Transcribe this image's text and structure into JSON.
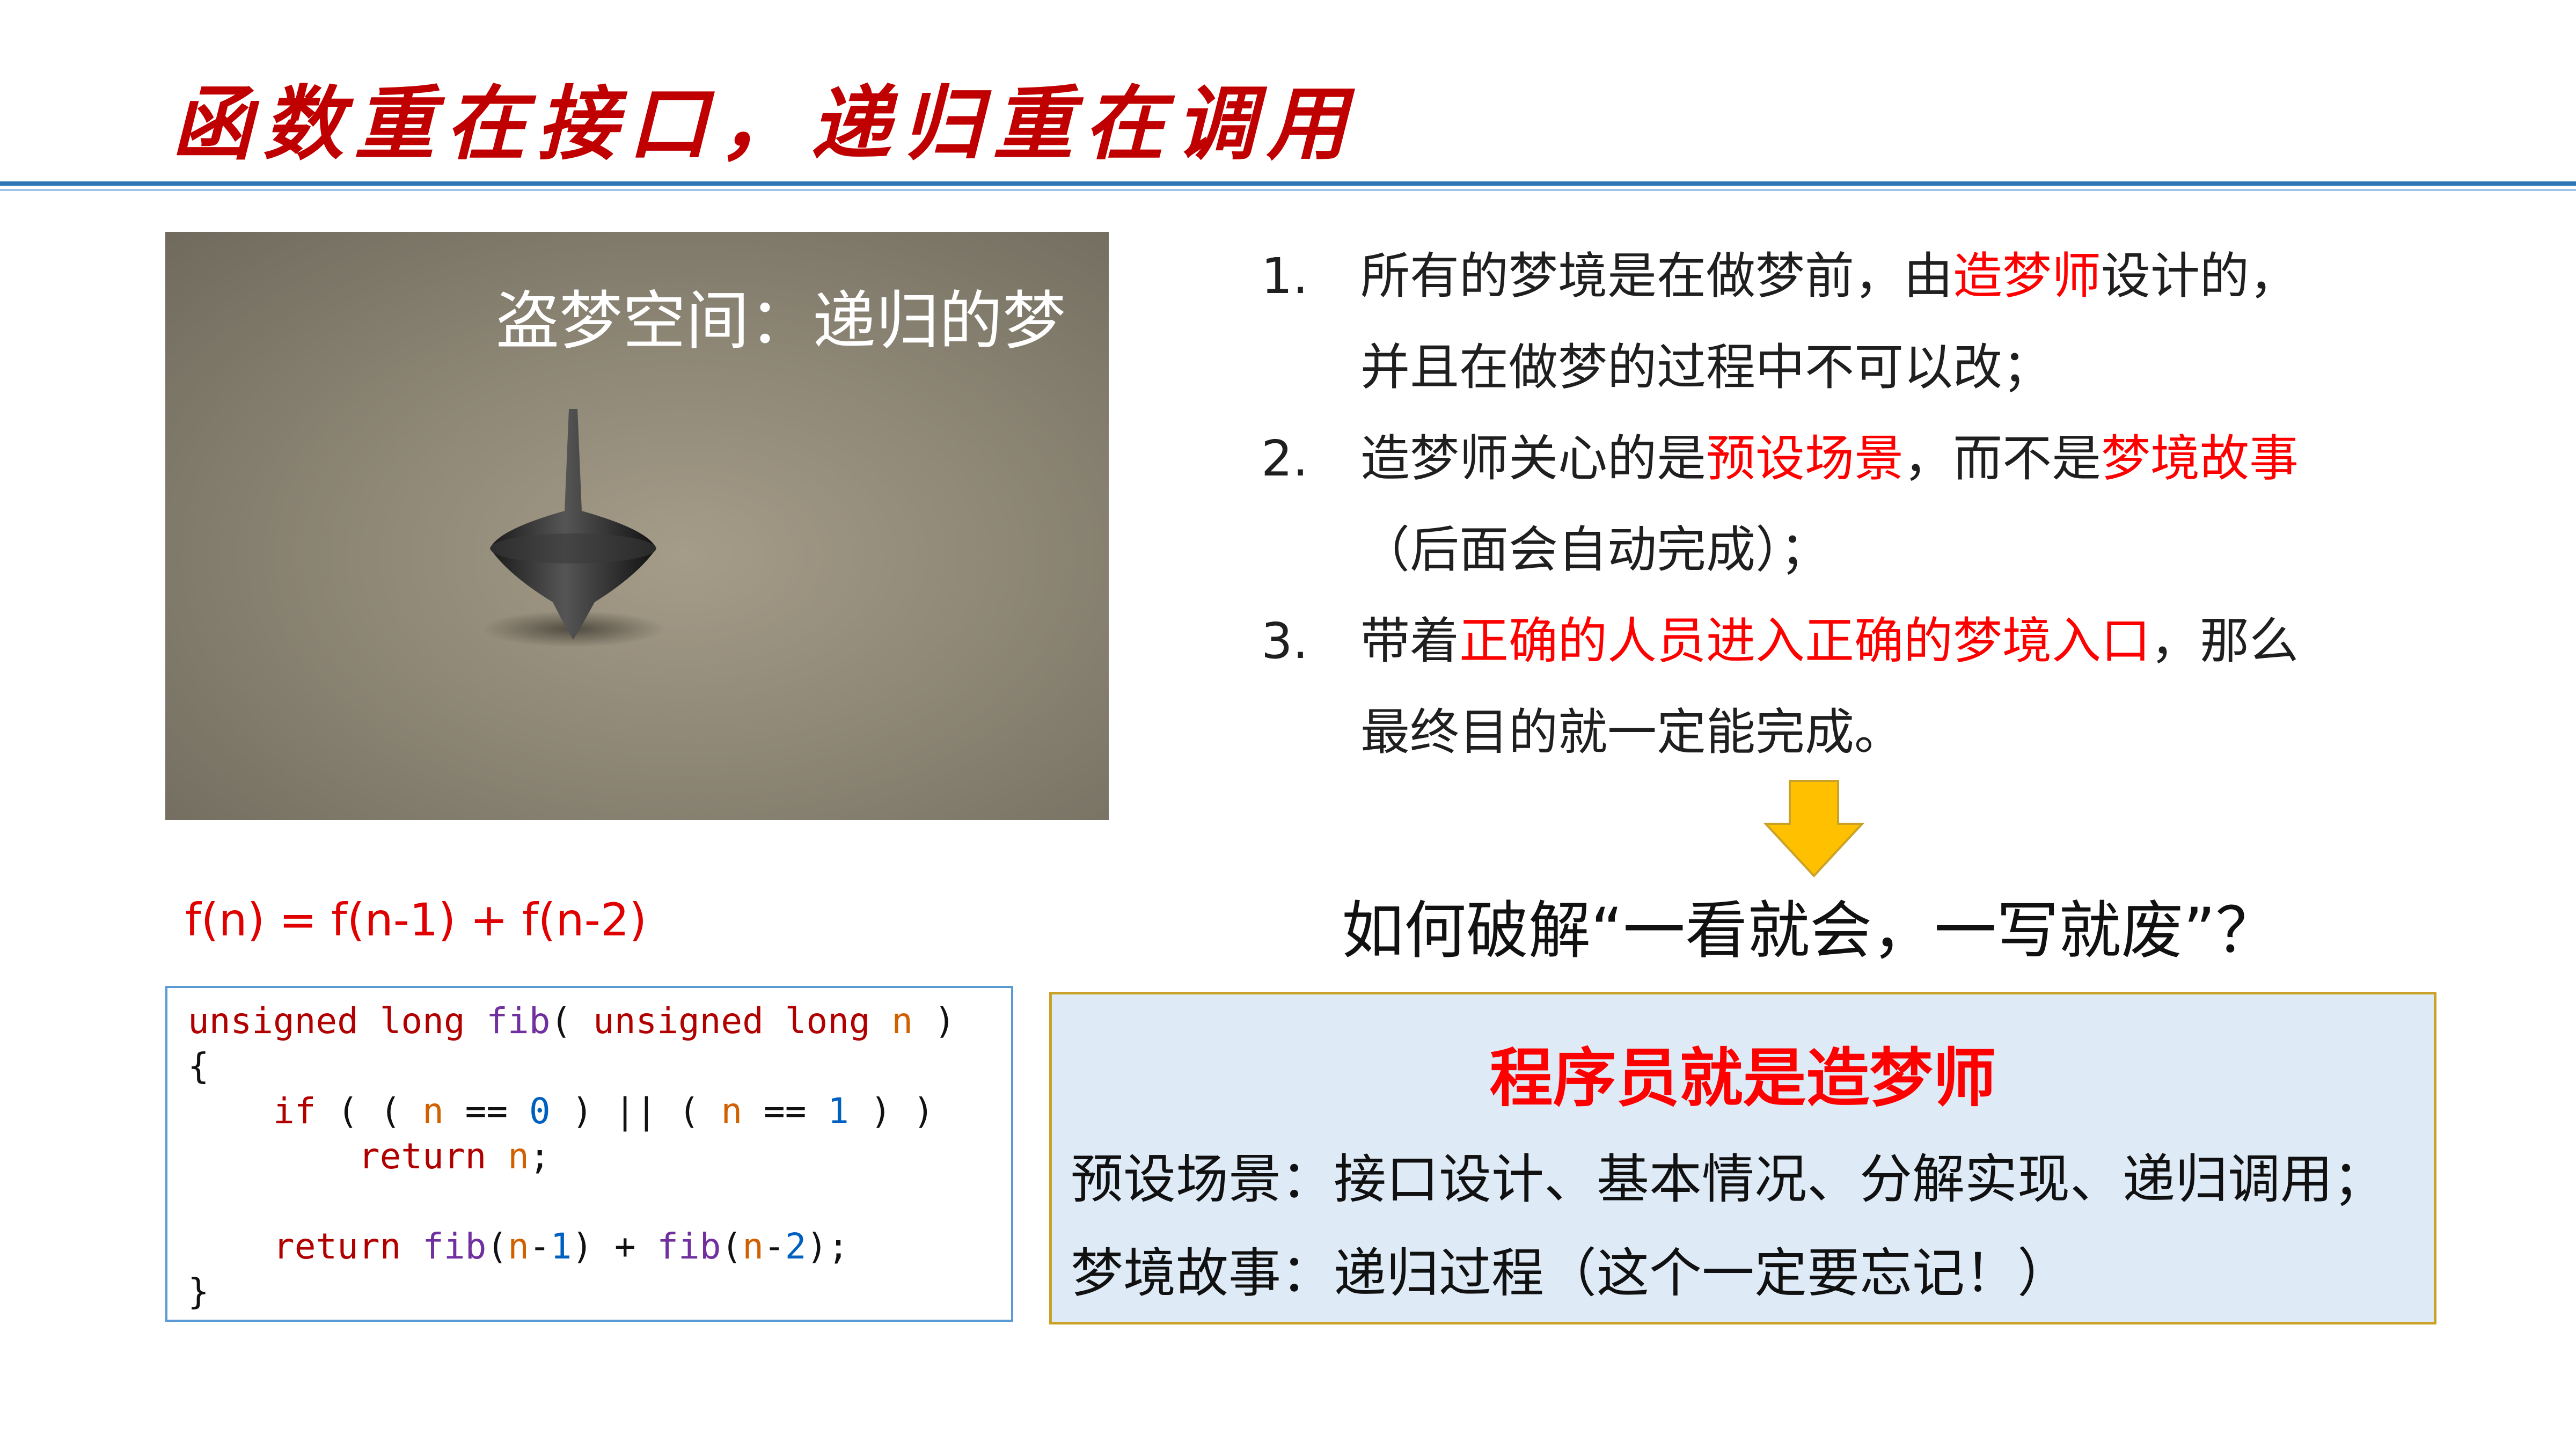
{
  "title": "函数重在接口，递归重在调用",
  "photo": {
    "caption": "盗梦空间：递归的梦",
    "icon": "spinning-top"
  },
  "list": [
    {
      "num": "1.",
      "line1": [
        {
          "text": "所有的梦境是在做梦前，由"
        },
        {
          "text": "造梦师",
          "hl": true
        },
        {
          "text": "设计的，"
        }
      ],
      "line2": [
        {
          "text": "并且在做梦的过程中不可以改；"
        }
      ]
    },
    {
      "num": "2.",
      "line1": [
        {
          "text": "造梦师关心的是"
        },
        {
          "text": "预设场景",
          "hl": true
        },
        {
          "text": "，而不是"
        },
        {
          "text": "梦境故事",
          "hl": true
        }
      ],
      "line2": [
        {
          "text": "（后面会自动完成）；"
        }
      ]
    },
    {
      "num": "3.",
      "line1": [
        {
          "text": "带着"
        },
        {
          "text": "正确的人员进入正确的梦境入口",
          "hl": true
        },
        {
          "text": "，那么"
        }
      ],
      "line2": [
        {
          "text": "最终目的就一定能完成。"
        }
      ]
    }
  ],
  "question": "如何破解“一看就会，一写就废”？",
  "formula": "f(n) = f(n-1) + f(n-2)",
  "code_lines": [
    [
      {
        "t": "unsigned long ",
        "c": "kw"
      },
      {
        "t": "fib",
        "c": "fn"
      },
      {
        "t": "( "
      },
      {
        "t": "unsigned long ",
        "c": "kw"
      },
      {
        "t": "n",
        "c": "var"
      },
      {
        "t": " )"
      }
    ],
    [
      {
        "t": "{"
      }
    ],
    [
      {
        "t": "    "
      },
      {
        "t": "if",
        "c": "kw"
      },
      {
        "t": " ( ( "
      },
      {
        "t": "n",
        "c": "var"
      },
      {
        "t": " == "
      },
      {
        "t": "0",
        "c": "lit"
      },
      {
        "t": " ) || ( "
      },
      {
        "t": "n",
        "c": "var"
      },
      {
        "t": " == "
      },
      {
        "t": "1",
        "c": "lit"
      },
      {
        "t": " ) )"
      }
    ],
    [
      {
        "t": "        "
      },
      {
        "t": "return",
        "c": "kw"
      },
      {
        "t": " "
      },
      {
        "t": "n",
        "c": "var"
      },
      {
        "t": ";"
      }
    ],
    [
      {
        "t": ""
      }
    ],
    [
      {
        "t": "    "
      },
      {
        "t": "return",
        "c": "kw"
      },
      {
        "t": " "
      },
      {
        "t": "fib",
        "c": "fn"
      },
      {
        "t": "("
      },
      {
        "t": "n",
        "c": "var"
      },
      {
        "t": "-"
      },
      {
        "t": "1",
        "c": "lit"
      },
      {
        "t": ") + "
      },
      {
        "t": "fib",
        "c": "fn"
      },
      {
        "t": "("
      },
      {
        "t": "n",
        "c": "var"
      },
      {
        "t": "-"
      },
      {
        "t": "2",
        "c": "lit"
      },
      {
        "t": ");"
      }
    ],
    [
      {
        "t": "}"
      }
    ]
  ],
  "dream_box": {
    "title": "程序员就是造梦师",
    "line1": "预设场景：接口设计、基本情况、分解实现、递归调用；",
    "line2": "梦境故事：递归过程（这个一定要忘记！）"
  }
}
